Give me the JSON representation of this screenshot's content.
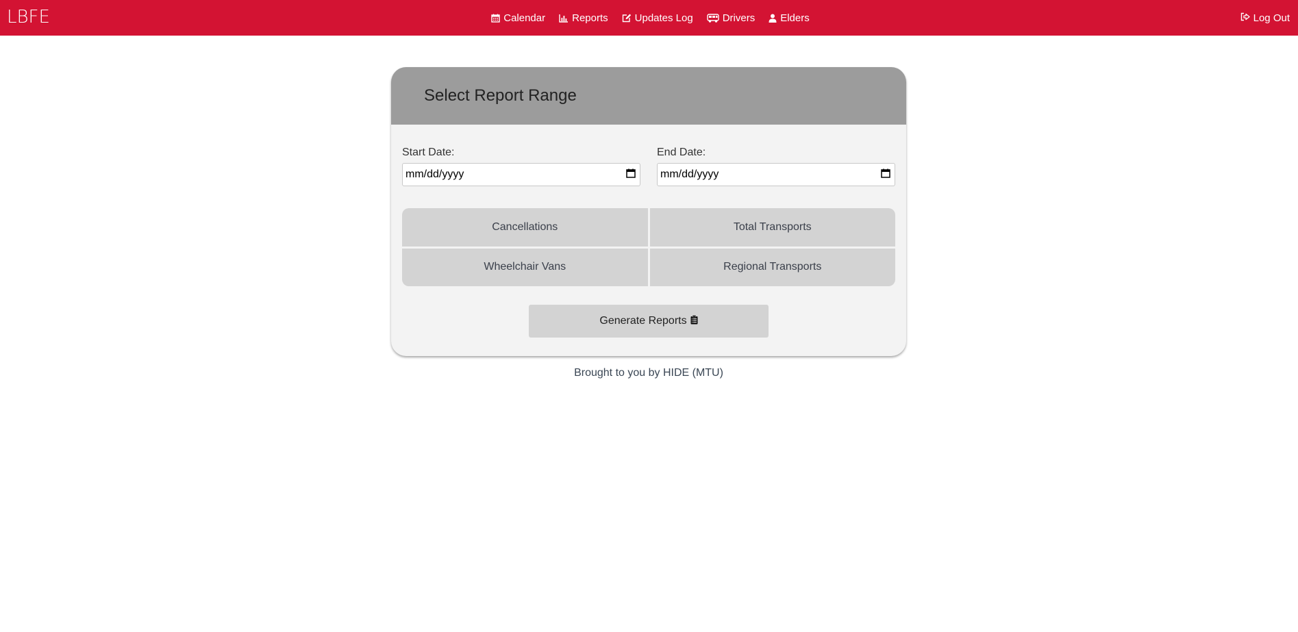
{
  "navbar": {
    "logo": "LBFE",
    "links": [
      {
        "label": "Calendar",
        "icon": "calendar-icon"
      },
      {
        "label": "Reports",
        "icon": "bar-chart-icon"
      },
      {
        "label": "Updates Log",
        "icon": "edit-icon"
      },
      {
        "label": "Drivers",
        "icon": "bus-icon"
      },
      {
        "label": "Elders",
        "icon": "user-icon"
      }
    ],
    "logout_label": "Log Out",
    "background_color": "#d31333"
  },
  "card": {
    "title": "Select Report Range",
    "start_date": {
      "label": "Start Date:",
      "value": "mm/dd/yyyy"
    },
    "end_date": {
      "label": "End Date:",
      "value": "mm/dd/yyyy"
    },
    "options": [
      "Cancellations",
      "Total Transports",
      "Wheelchair Vans",
      "Regional Transports"
    ],
    "generate_label": "Generate Reports"
  },
  "footer": {
    "text": "Brought to you by HIDE (MTU)"
  }
}
